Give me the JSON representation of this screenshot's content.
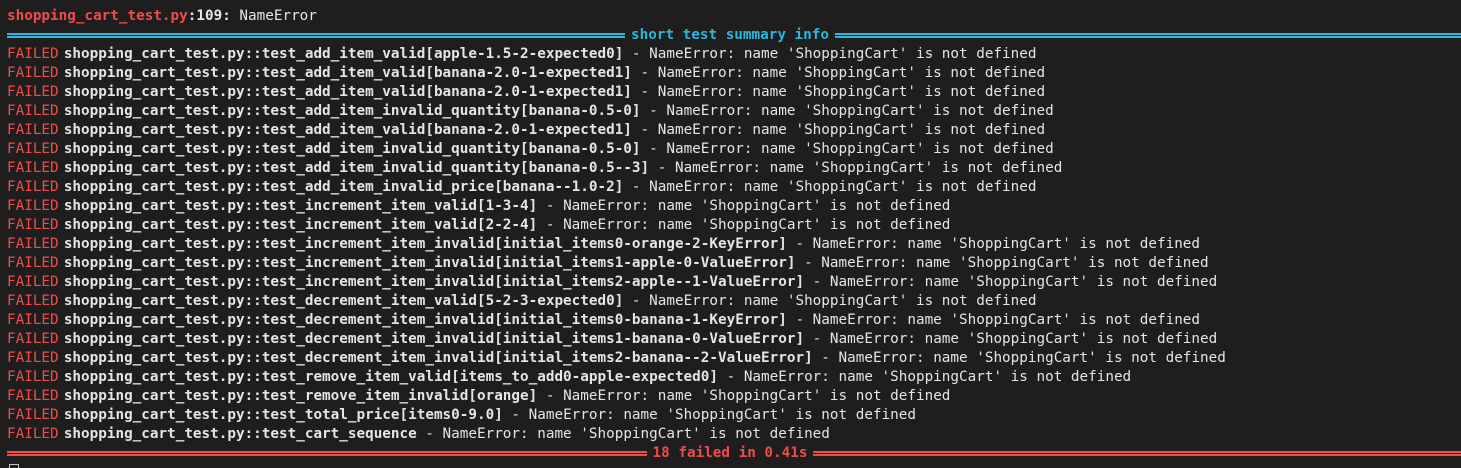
{
  "header": {
    "file": "shopping_cart_test.py",
    "location": ":109:",
    "error": " NameError"
  },
  "summary_title": "short test summary info",
  "failures": [
    {
      "status": "FAILED",
      "path": "shopping_cart_test.py::",
      "test": "test_add_item_valid[apple-1.5-2-expected0]",
      "message": " - NameError: name 'ShoppingCart' is not defined"
    },
    {
      "status": "FAILED",
      "path": "shopping_cart_test.py::",
      "test": "test_add_item_valid[banana-2.0-1-expected1]",
      "message": " - NameError: name 'ShoppingCart' is not defined"
    },
    {
      "status": "FAILED",
      "path": "shopping_cart_test.py::",
      "test": "test_add_item_valid[banana-2.0-1-expected1]",
      "message": " - NameError: name 'ShoppingCart' is not defined"
    },
    {
      "status": "FAILED",
      "path": "shopping_cart_test.py::",
      "test": "test_add_item_invalid_quantity[banana-0.5-0]",
      "message": " - NameError: name 'ShoppingCart' is not defined"
    },
    {
      "status": "FAILED",
      "path": "shopping_cart_test.py::",
      "test": "test_add_item_valid[banana-2.0-1-expected1]",
      "message": " - NameError: name 'ShoppingCart' is not defined"
    },
    {
      "status": "FAILED",
      "path": "shopping_cart_test.py::",
      "test": "test_add_item_invalid_quantity[banana-0.5-0]",
      "message": " - NameError: name 'ShoppingCart' is not defined"
    },
    {
      "status": "FAILED",
      "path": "shopping_cart_test.py::",
      "test": "test_add_item_invalid_quantity[banana-0.5--3]",
      "message": " - NameError: name 'ShoppingCart' is not defined"
    },
    {
      "status": "FAILED",
      "path": "shopping_cart_test.py::",
      "test": "test_add_item_invalid_price[banana--1.0-2]",
      "message": " - NameError: name 'ShoppingCart' is not defined"
    },
    {
      "status": "FAILED",
      "path": "shopping_cart_test.py::",
      "test": "test_increment_item_valid[1-3-4]",
      "message": " - NameError: name 'ShoppingCart' is not defined"
    },
    {
      "status": "FAILED",
      "path": "shopping_cart_test.py::",
      "test": "test_increment_item_valid[2-2-4]",
      "message": " - NameError: name 'ShoppingCart' is not defined"
    },
    {
      "status": "FAILED",
      "path": "shopping_cart_test.py::",
      "test": "test_increment_item_invalid[initial_items0-orange-2-KeyError]",
      "message": " - NameError: name 'ShoppingCart' is not defined"
    },
    {
      "status": "FAILED",
      "path": "shopping_cart_test.py::",
      "test": "test_increment_item_invalid[initial_items1-apple-0-ValueError]",
      "message": " - NameError: name 'ShoppingCart' is not defined"
    },
    {
      "status": "FAILED",
      "path": "shopping_cart_test.py::",
      "test": "test_increment_item_invalid[initial_items2-apple--1-ValueError]",
      "message": " - NameError: name 'ShoppingCart' is not defined"
    },
    {
      "status": "FAILED",
      "path": "shopping_cart_test.py::",
      "test": "test_decrement_item_valid[5-2-3-expected0]",
      "message": " - NameError: name 'ShoppingCart' is not defined"
    },
    {
      "status": "FAILED",
      "path": "shopping_cart_test.py::",
      "test": "test_decrement_item_invalid[initial_items0-banana-1-KeyError]",
      "message": " - NameError: name 'ShoppingCart' is not defined"
    },
    {
      "status": "FAILED",
      "path": "shopping_cart_test.py::",
      "test": "test_decrement_item_invalid[initial_items1-banana-0-ValueError]",
      "message": " - NameError: name 'ShoppingCart' is not defined"
    },
    {
      "status": "FAILED",
      "path": "shopping_cart_test.py::",
      "test": "test_decrement_item_invalid[initial_items2-banana--2-ValueError]",
      "message": " - NameError: name 'ShoppingCart' is not defined"
    },
    {
      "status": "FAILED",
      "path": "shopping_cart_test.py::",
      "test": "test_remove_item_valid[items_to_add0-apple-expected0]",
      "message": " - NameError: name 'ShoppingCart' is not defined"
    },
    {
      "status": "FAILED",
      "path": "shopping_cart_test.py::",
      "test": "test_remove_item_invalid[orange]",
      "message": " - NameError: name 'ShoppingCart' is not defined"
    },
    {
      "status": "FAILED",
      "path": "shopping_cart_test.py::",
      "test": "test_total_price[items0-9.0]",
      "message": " - NameError: name 'ShoppingCart' is not defined"
    },
    {
      "status": "FAILED",
      "path": "shopping_cart_test.py::",
      "test": "test_cart_sequence",
      "message": " - NameError: name 'ShoppingCart' is not defined"
    }
  ],
  "result_summary": "18 failed in 0.41s",
  "colors": {
    "failed": "#f14c4c",
    "separator_info": "#29b8db",
    "text": "#e5e5e5",
    "background": "#1e1e1e"
  }
}
